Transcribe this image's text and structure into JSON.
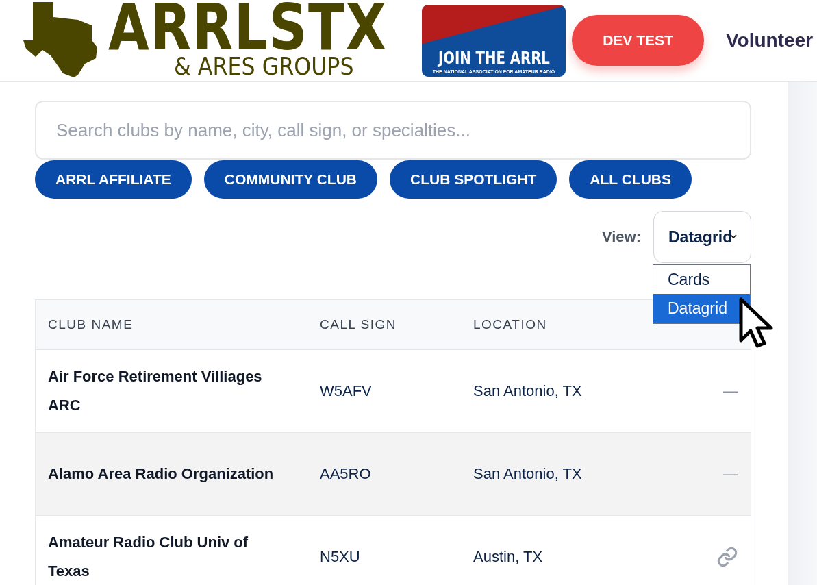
{
  "header": {
    "logo": {
      "title": "ARRLSTX",
      "subtitle": "& ARES GROUPS"
    },
    "banner": {
      "title": "JOIN THE ARRL",
      "subtitle": "THE NATIONAL ASSOCIATION FOR AMATEUR RADIO"
    },
    "dev_button": "DEV TEST",
    "nav_link": "Volunteer"
  },
  "search": {
    "placeholder": "Search clubs by name, city, call sign, or specialties..."
  },
  "filters": [
    {
      "label": "ARRL AFFILIATE"
    },
    {
      "label": "COMMUNITY CLUB"
    },
    {
      "label": "CLUB SPOTLIGHT"
    },
    {
      "label": "ALL CLUBS"
    }
  ],
  "view": {
    "label": "View:",
    "value": "Datagrid",
    "options": [
      {
        "label": "Cards",
        "selected": false
      },
      {
        "label": "Datagrid",
        "selected": true
      }
    ]
  },
  "table": {
    "columns": [
      "CLUB NAME",
      "CALL SIGN",
      "LOCATION"
    ],
    "rows": [
      {
        "name": "Air Force Retirement Villiages ARC",
        "call_sign": "W5AFV",
        "location": "San Antonio, TX",
        "website": "—",
        "has_link": false,
        "hovered": false
      },
      {
        "name": "Alamo Area Radio Organization",
        "call_sign": "AA5RO",
        "location": "San Antonio, TX",
        "website": "—",
        "has_link": false,
        "hovered": true
      },
      {
        "name": "Amateur Radio Club Univ of Texas",
        "call_sign": "N5XU",
        "location": "Austin, TX",
        "has_link": true,
        "hovered": false
      }
    ]
  }
}
